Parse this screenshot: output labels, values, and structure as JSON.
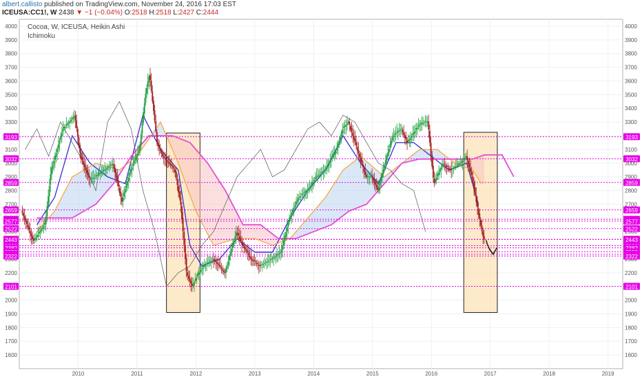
{
  "header": {
    "author": "albert.callisto",
    "published_text": "published on TradingView.com, November 24, 2016 17:03 EST",
    "symbol": "ICEUSA:CC1!, W",
    "last": "2438",
    "change": "−1 (−0.04%)",
    "o_label": "O:",
    "o_value": "2518",
    "h_label": "H:",
    "h_value": "2518",
    "l_label": "L:",
    "l_value": "2427",
    "c_label": "C:",
    "c_value": "2444"
  },
  "legend": {
    "series_name": "Cocoa, W, ICEUSA, Heikin Ashi",
    "indicator": "Ichimoku"
  },
  "colors": {
    "bull": "#1e9e3e",
    "bear": "#9e1b1b",
    "level": "#e600e6",
    "tenkan": "#3b3bd1",
    "kijun": "#f7a53c",
    "span_b": "#e64ed3",
    "chikou": "#555555",
    "cloud_bull": "#b9d3f0",
    "cloud_bear": "#f7c5c5",
    "highlight_fill": "#fbe3b8",
    "highlight_stroke": "#222222"
  },
  "chart_data": {
    "type": "candlestick",
    "title": "Cocoa, W, ICEUSA, Heikin Ashi",
    "x_range": [
      2009.0,
      2019.25
    ],
    "y_range": [
      1500,
      4050
    ],
    "y_ticks": [
      1600,
      1700,
      1800,
      1900,
      2000,
      2100,
      2200,
      2300,
      2400,
      2500,
      2600,
      2700,
      2800,
      2900,
      3000,
      3100,
      3200,
      3300,
      3400,
      3500,
      3600,
      3700,
      3800,
      3900,
      4000
    ],
    "x_tick_labels": [
      "2010",
      "2011",
      "2012",
      "2013",
      "2014",
      "2015",
      "2016",
      "2017",
      "2018",
      "2019"
    ],
    "x_tick_values": [
      2010,
      2011,
      2012,
      2013,
      2014,
      2015,
      2016,
      2017,
      2018,
      2019
    ],
    "price_path": [
      [
        2009.05,
        2650
      ],
      [
        2009.25,
        2430
      ],
      [
        2009.45,
        2560
      ],
      [
        2009.55,
        2950
      ],
      [
        2009.75,
        3250
      ],
      [
        2009.95,
        3350
      ],
      [
        2010.05,
        3050
      ],
      [
        2010.2,
        2880
      ],
      [
        2010.3,
        2900
      ],
      [
        2010.45,
        2950
      ],
      [
        2010.6,
        3000
      ],
      [
        2010.75,
        2720
      ],
      [
        2010.9,
        2950
      ],
      [
        2011.05,
        3100
      ],
      [
        2011.15,
        3500
      ],
      [
        2011.22,
        3650
      ],
      [
        2011.35,
        3150
      ],
      [
        2011.45,
        3050
      ],
      [
        2011.55,
        3000
      ],
      [
        2011.65,
        2950
      ],
      [
        2011.75,
        2700
      ],
      [
        2011.85,
        2200
      ],
      [
        2011.95,
        2100
      ],
      [
        2012.05,
        2200
      ],
      [
        2012.15,
        2250
      ],
      [
        2012.3,
        2300
      ],
      [
        2012.5,
        2200
      ],
      [
        2012.6,
        2350
      ],
      [
        2012.7,
        2500
      ],
      [
        2012.8,
        2400
      ],
      [
        2012.95,
        2300
      ],
      [
        2013.1,
        2250
      ],
      [
        2013.3,
        2300
      ],
      [
        2013.45,
        2350
      ],
      [
        2013.6,
        2600
      ],
      [
        2013.75,
        2750
      ],
      [
        2013.9,
        2800
      ],
      [
        2014.05,
        2900
      ],
      [
        2014.2,
        2950
      ],
      [
        2014.4,
        3100
      ],
      [
        2014.5,
        3250
      ],
      [
        2014.6,
        3300
      ],
      [
        2014.75,
        3100
      ],
      [
        2014.9,
        2900
      ],
      [
        2015.0,
        2900
      ],
      [
        2015.1,
        2800
      ],
      [
        2015.25,
        3050
      ],
      [
        2015.35,
        3200
      ],
      [
        2015.5,
        3250
      ],
      [
        2015.6,
        3150
      ],
      [
        2015.75,
        3250
      ],
      [
        2015.85,
        3300
      ],
      [
        2015.95,
        3300
      ],
      [
        2016.05,
        2850
      ],
      [
        2016.2,
        3000
      ],
      [
        2016.35,
        2950
      ],
      [
        2016.5,
        3000
      ],
      [
        2016.6,
        3050
      ],
      [
        2016.7,
        2900
      ],
      [
        2016.8,
        2650
      ],
      [
        2016.88,
        2480
      ],
      [
        2016.9,
        2444
      ]
    ],
    "series": [
      {
        "name": "Tenkan",
        "points": [
          [
            2009.3,
            2550
          ],
          [
            2009.6,
            2750
          ],
          [
            2009.9,
            3200
          ],
          [
            2010.2,
            3000
          ],
          [
            2010.5,
            2900
          ],
          [
            2010.8,
            2850
          ],
          [
            2011.1,
            3350
          ],
          [
            2011.4,
            3100
          ],
          [
            2011.7,
            2950
          ],
          [
            2011.9,
            2400
          ],
          [
            2012.1,
            2250
          ],
          [
            2012.4,
            2300
          ],
          [
            2012.7,
            2450
          ],
          [
            2013.0,
            2350
          ],
          [
            2013.3,
            2350
          ],
          [
            2013.6,
            2600
          ],
          [
            2013.9,
            2800
          ],
          [
            2014.2,
            2950
          ],
          [
            2014.5,
            3200
          ],
          [
            2014.8,
            3000
          ],
          [
            2015.1,
            2850
          ],
          [
            2015.4,
            3150
          ],
          [
            2015.7,
            3150
          ],
          [
            2016.0,
            3050
          ],
          [
            2016.3,
            2950
          ],
          [
            2016.6,
            3000
          ],
          [
            2016.8,
            2700
          ]
        ]
      },
      {
        "name": "Kijun",
        "points": [
          [
            2009.3,
            2500
          ],
          [
            2009.6,
            2650
          ],
          [
            2009.9,
            2900
          ],
          [
            2010.3,
            3000
          ],
          [
            2010.7,
            2950
          ],
          [
            2011.0,
            3050
          ],
          [
            2011.4,
            3300
          ],
          [
            2011.7,
            3000
          ],
          [
            2012.0,
            2650
          ],
          [
            2012.3,
            2400
          ],
          [
            2012.7,
            2450
          ],
          [
            2013.0,
            2450
          ],
          [
            2013.3,
            2400
          ],
          [
            2013.6,
            2450
          ],
          [
            2013.9,
            2600
          ],
          [
            2014.2,
            2750
          ],
          [
            2014.5,
            2950
          ],
          [
            2014.8,
            3050
          ],
          [
            2015.2,
            2900
          ],
          [
            2015.5,
            3000
          ],
          [
            2015.8,
            3100
          ],
          [
            2016.1,
            3100
          ],
          [
            2016.4,
            3000
          ],
          [
            2016.7,
            2950
          ],
          [
            2016.85,
            2850
          ]
        ]
      },
      {
        "name": "Senkou Span B",
        "points": [
          [
            2009.3,
            2600
          ],
          [
            2009.6,
            2600
          ],
          [
            2009.9,
            2600
          ],
          [
            2010.3,
            2700
          ],
          [
            2010.6,
            2850
          ],
          [
            2010.9,
            3050
          ],
          [
            2011.2,
            3200
          ],
          [
            2011.4,
            3200
          ],
          [
            2011.6,
            3200
          ],
          [
            2011.9,
            3150
          ],
          [
            2012.2,
            3000
          ],
          [
            2012.5,
            2800
          ],
          [
            2012.8,
            2550
          ],
          [
            2013.1,
            2550
          ],
          [
            2013.4,
            2450
          ],
          [
            2013.7,
            2450
          ],
          [
            2014.0,
            2500
          ],
          [
            2014.3,
            2550
          ],
          [
            2014.6,
            2650
          ],
          [
            2014.9,
            2700
          ],
          [
            2015.2,
            2850
          ],
          [
            2015.5,
            3000
          ],
          [
            2015.8,
            3030
          ],
          [
            2016.1,
            3030
          ],
          [
            2016.4,
            3030
          ],
          [
            2016.7,
            3030
          ],
          [
            2016.9,
            3060
          ],
          [
            2017.2,
            3060
          ],
          [
            2017.4,
            2900
          ]
        ]
      },
      {
        "name": "Chikou",
        "points": [
          [
            2009.1,
            3100
          ],
          [
            2009.3,
            3250
          ],
          [
            2009.5,
            3050
          ],
          [
            2009.7,
            3300
          ],
          [
            2009.9,
            3150
          ],
          [
            2010.1,
            3000
          ],
          [
            2010.3,
            2800
          ],
          [
            2010.5,
            3300
          ],
          [
            2010.7,
            3450
          ],
          [
            2010.9,
            3250
          ],
          [
            2011.1,
            2800
          ],
          [
            2011.3,
            2500
          ],
          [
            2011.5,
            2100
          ],
          [
            2011.7,
            2200
          ],
          [
            2011.9,
            2250
          ],
          [
            2012.1,
            2400
          ],
          [
            2012.3,
            2500
          ],
          [
            2012.5,
            2700
          ],
          [
            2012.7,
            2900
          ],
          [
            2012.9,
            3000
          ],
          [
            2013.1,
            3100
          ],
          [
            2013.3,
            2900
          ],
          [
            2013.5,
            2950
          ],
          [
            2013.7,
            3100
          ],
          [
            2013.9,
            3250
          ],
          [
            2014.1,
            3300
          ],
          [
            2014.3,
            3200
          ],
          [
            2014.5,
            3350
          ],
          [
            2014.7,
            3300
          ],
          [
            2014.9,
            3150
          ],
          [
            2015.1,
            3000
          ],
          [
            2015.3,
            2950
          ],
          [
            2015.5,
            2850
          ],
          [
            2015.7,
            2800
          ],
          [
            2015.9,
            2500
          ]
        ]
      }
    ],
    "levels": [
      3193,
      3032,
      2859,
      2659,
      2590,
      2577,
      2522,
      2444,
      2443,
      2398,
      2382,
      2353,
      2335,
      2322,
      2101
    ],
    "current_price": 2444,
    "highlight_boxes": [
      {
        "x1": 2011.5,
        "x2": 2012.07,
        "y1": 1910,
        "y2": 3220
      },
      {
        "x1": 2016.55,
        "x2": 2017.12,
        "y1": 1910,
        "y2": 3225
      }
    ],
    "arrow": {
      "from": [
        2016.93,
        2438
      ],
      "to": [
        2017.05,
        2335
      ]
    },
    "grid": true,
    "legend_position": "top-left"
  }
}
